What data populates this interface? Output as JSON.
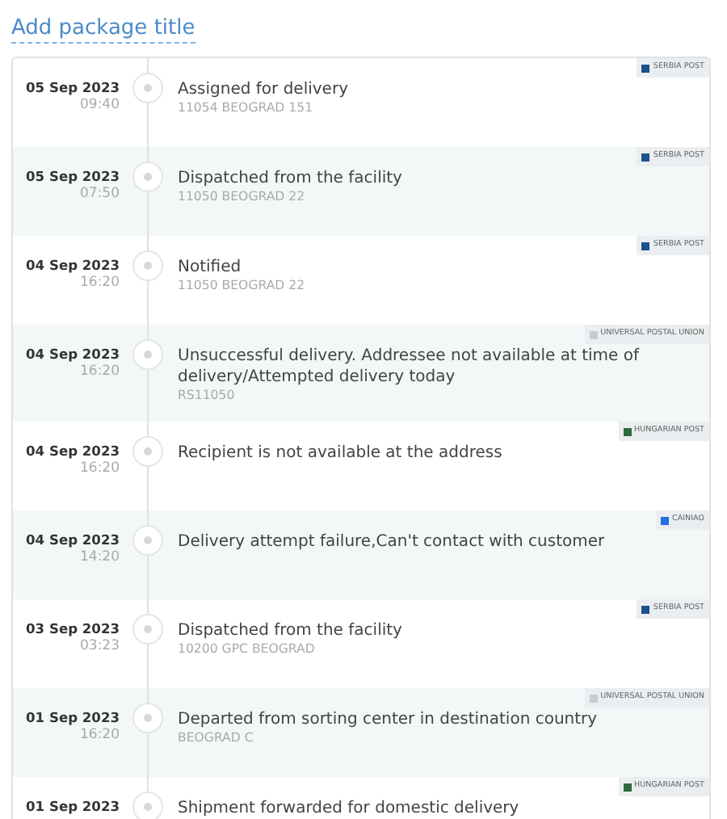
{
  "title_link": "Add package title",
  "events": [
    {
      "date": "05 Sep 2023",
      "time": "09:40",
      "status": "Assigned for delivery",
      "location": "11054 BEOGRAD 151",
      "carrier": {
        "name": "SERBIA POST",
        "color": "#1d4f8c"
      }
    },
    {
      "date": "05 Sep 2023",
      "time": "07:50",
      "status": "Dispatched from the facility",
      "location": "11050 BEOGRAD 22",
      "carrier": {
        "name": "SERBIA POST",
        "color": "#1d4f8c"
      }
    },
    {
      "date": "04 Sep 2023",
      "time": "16:20",
      "status": "Notified",
      "location": "11050 BEOGRAD 22",
      "carrier": {
        "name": "SERBIA POST",
        "color": "#1d4f8c"
      }
    },
    {
      "date": "04 Sep 2023",
      "time": "16:20",
      "status": "Unsuccessful delivery. Addressee not available at time of delivery/Attempted delivery today",
      "location": "RS11050",
      "carrier": {
        "name": "UNIVERSAL POSTAL UNION",
        "color": "#c8ccd0"
      }
    },
    {
      "date": "04 Sep 2023",
      "time": "16:20",
      "status": "Recipient is not available at the address",
      "carrier": {
        "name": "HUNGARIAN POST",
        "color": "#2d6a3c"
      }
    },
    {
      "date": "04 Sep 2023",
      "time": "14:20",
      "status": "Delivery attempt failure,Can't contact with customer",
      "carrier": {
        "name": "CAINIAO",
        "color": "#1f6fe5"
      }
    },
    {
      "date": "03 Sep 2023",
      "time": "03:23",
      "status": "Dispatched from the facility",
      "location": "10200 GPC BEOGRAD",
      "carrier": {
        "name": "SERBIA POST",
        "color": "#1d4f8c"
      }
    },
    {
      "date": "01 Sep 2023",
      "time": "16:20",
      "status": "Departed from sorting center in destination country",
      "location": "BEOGRAD C",
      "carrier": {
        "name": "UNIVERSAL POSTAL UNION",
        "color": "#c8ccd0"
      }
    },
    {
      "date": "01 Sep 2023",
      "status": "Shipment forwarded for domestic delivery",
      "carrier": {
        "name": "HUNGARIAN POST",
        "color": "#2d6a3c"
      }
    }
  ]
}
